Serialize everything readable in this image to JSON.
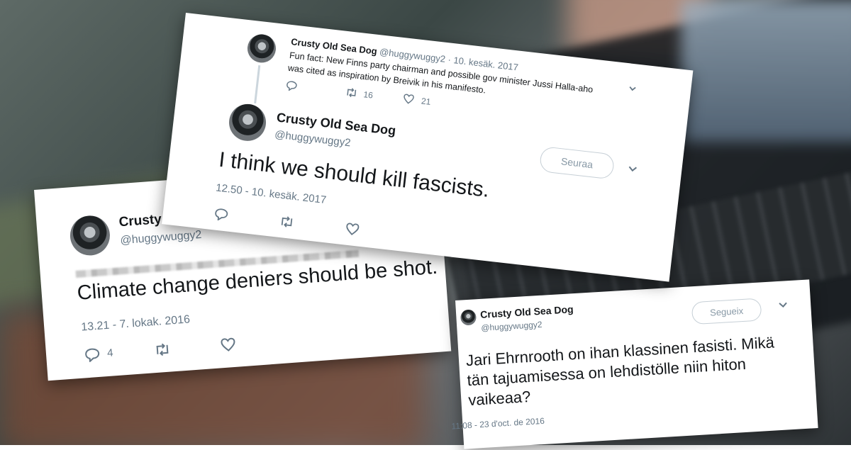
{
  "background": {
    "description_colors": {
      "accent": "#1da1f2"
    }
  },
  "card_a": {
    "parent": {
      "name": "Crusty Old Sea Dog",
      "handle": "@huggywuggy2",
      "date": "· 10. kesäk. 2017",
      "text_line1": "Fun fact: New Finns party chairman and possible gov minister Jussi Halla-aho",
      "text_line2": "was cited as inspiration by Breivik in his manifesto.",
      "retweets": "16",
      "likes": "21"
    },
    "main": {
      "name": "Crusty Old Sea Dog",
      "handle": "@huggywuggy2",
      "follow_label": "Seuraa",
      "text": "I think we should kill fascists.",
      "timestamp": "12.50 - 10. kesäk. 2017"
    }
  },
  "card_b": {
    "name": "Crusty Old",
    "handle": "@huggywuggy2",
    "text": "Climate change deniers should be shot.",
    "timestamp": "13.21 - 7. lokak. 2016",
    "replies": "4"
  },
  "card_c": {
    "name": "Crusty Old Sea Dog",
    "handle": "@huggywuggy2",
    "follow_label": "Segueix",
    "text_line1": "Jari Ehrnrooth on ihan klassinen fasisti. Mikä",
    "text_line2": "tän tajuamisessa on lehdistölle niin hiton",
    "text_line3": "vaikeaa?",
    "timestamp": "11:08 - 23 d'oct. de 2016"
  }
}
